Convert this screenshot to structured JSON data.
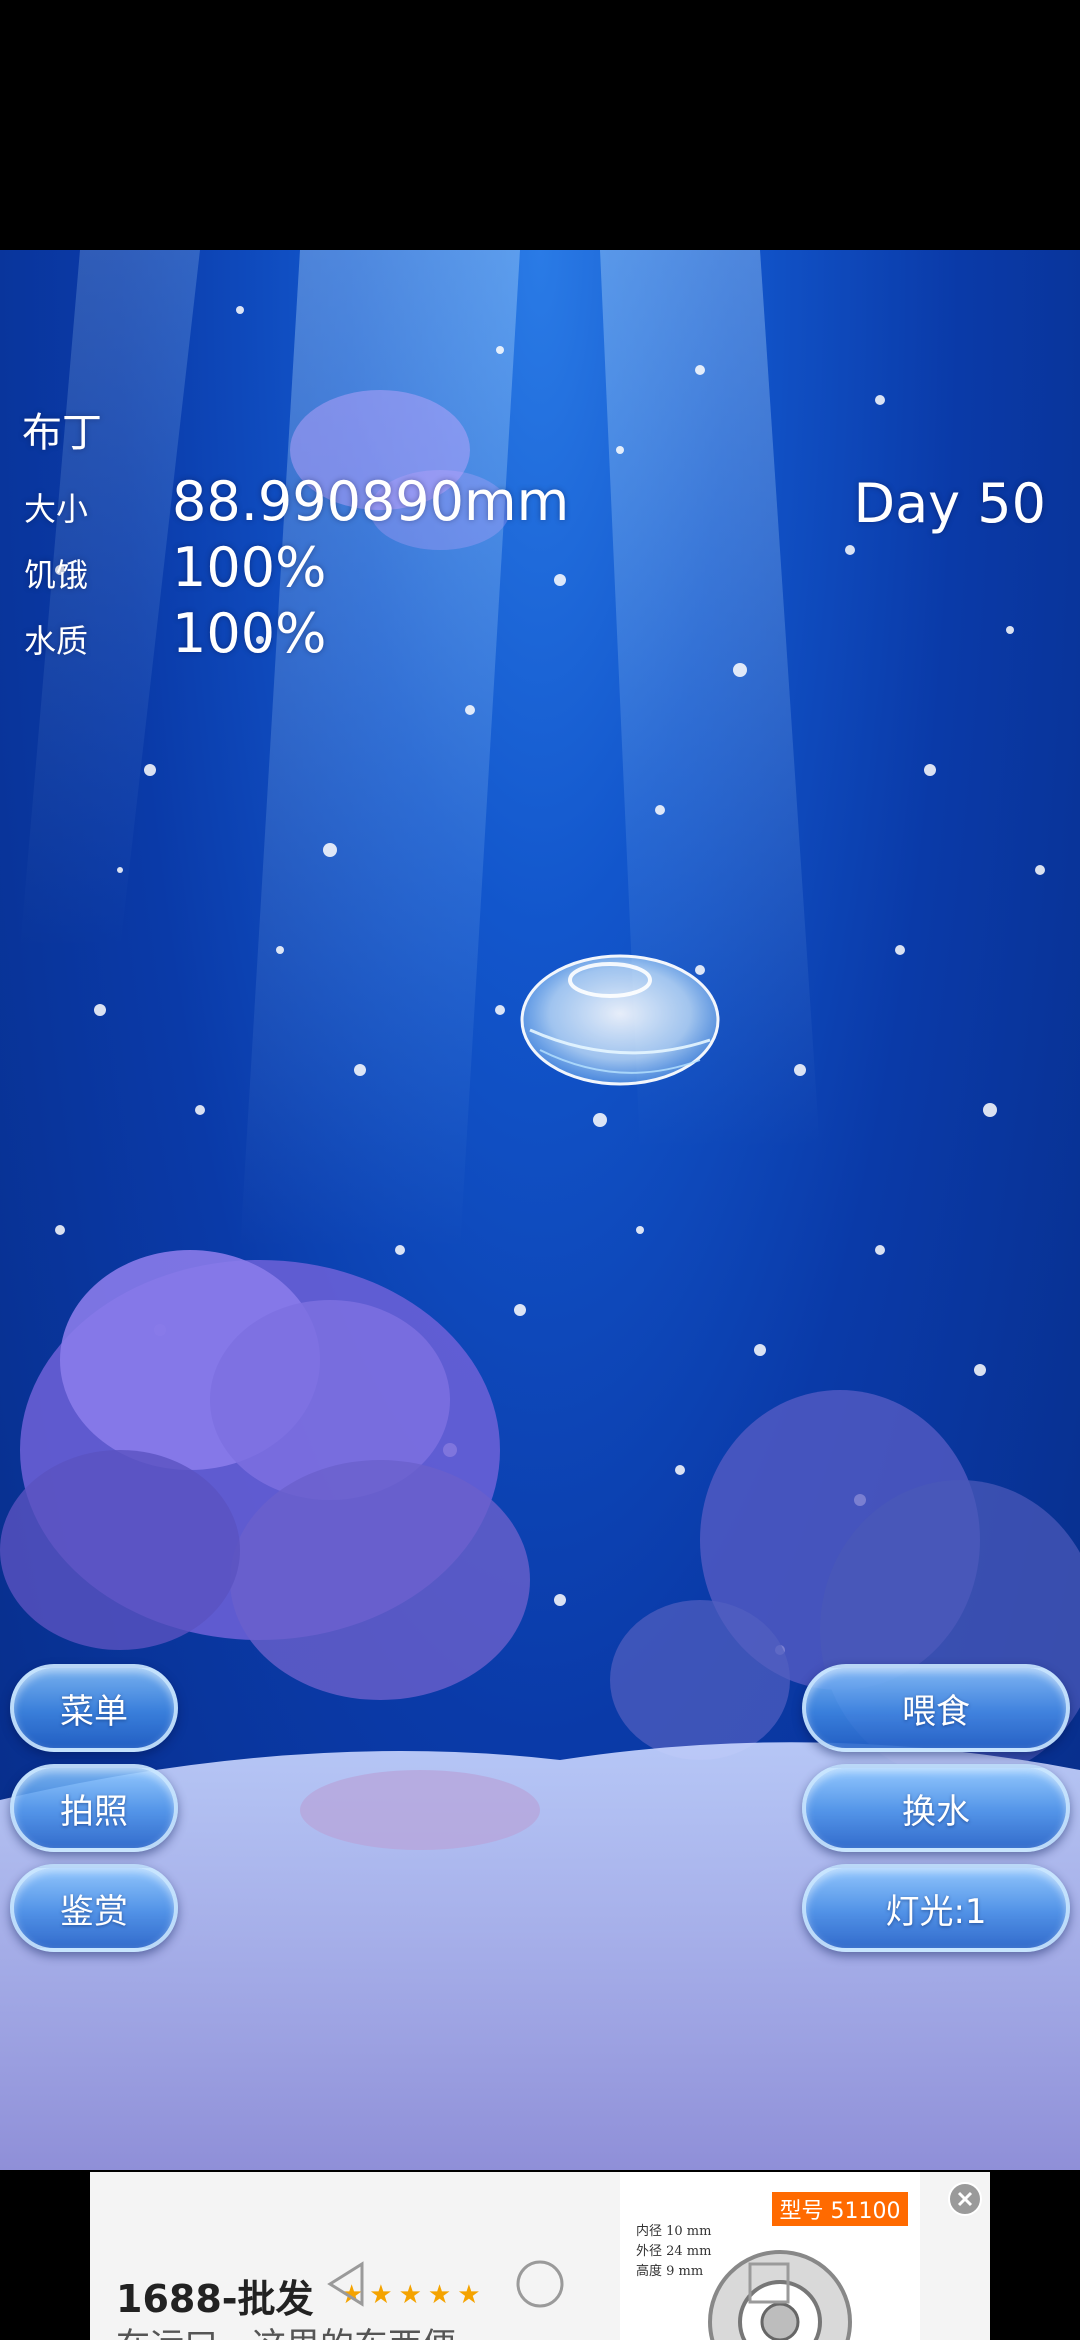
{
  "pet": {
    "name": "布丁",
    "size_label": "大小",
    "size_value": "88.990890mm",
    "hunger_label": "饥饿",
    "hunger_value": "100%",
    "water_label": "水质",
    "water_value": "100%",
    "day": "Day 50"
  },
  "buttons": {
    "menu": "菜单",
    "photo": "拍照",
    "gallery": "鉴赏",
    "feed": "喂食",
    "change_water": "换水",
    "light": "灯光:1"
  },
  "ad": {
    "title": "1688-批发",
    "stars": "★★★★★",
    "subtitle": "在运口，这里的东西便",
    "tag": "型号  51100",
    "spec_inner": "内径 10 mm",
    "spec_outer": "外径 24 mm",
    "spec_height": "高度 9 mm"
  },
  "icons": {
    "ad_close": "close-icon",
    "nav_back": "back-icon",
    "nav_home": "home-icon",
    "nav_recent": "recent-apps-icon"
  },
  "colors": {
    "water_top": "#2a7be6",
    "water_bottom": "#072c86",
    "button_border": "#d2ebff",
    "ad_tag": "#ff6a00",
    "ad_stars": "#f4a300"
  }
}
